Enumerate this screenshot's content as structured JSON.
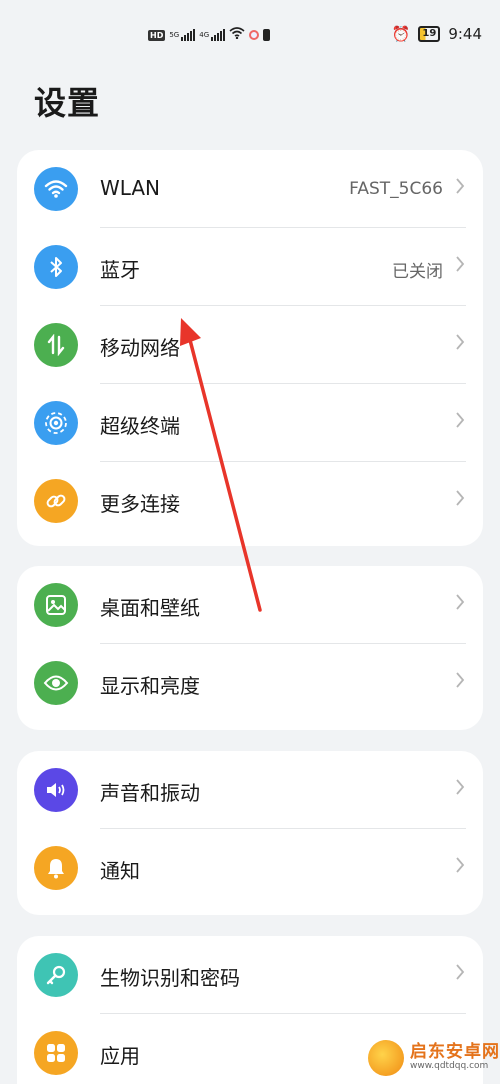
{
  "status_bar": {
    "hd_badge": "HD",
    "sim1_net": "5G",
    "sim2_net": "4G",
    "battery_level": "19",
    "time": "9:44",
    "icons": [
      "hd-icon",
      "signal-icon",
      "signal-icon",
      "wifi-icon",
      "app-dot-icon",
      "battery-small-icon",
      "alarm-icon",
      "battery-icon"
    ]
  },
  "header": {
    "title": "设置"
  },
  "groups": [
    {
      "items": [
        {
          "label": "WLAN",
          "value": "FAST_5C66",
          "icon": "wifi-icon",
          "color": "#3a9ef0"
        },
        {
          "label": "蓝牙",
          "value": "已关闭",
          "icon": "bluetooth-icon",
          "color": "#3a9ef0"
        },
        {
          "label": "移动网络",
          "value": "",
          "icon": "mobile-data-icon",
          "color": "#4caf50"
        },
        {
          "label": "超级终端",
          "value": "",
          "icon": "super-device-icon",
          "color": "#3a9ef0"
        },
        {
          "label": "更多连接",
          "value": "",
          "icon": "link-icon",
          "color": "#f5a623"
        }
      ]
    },
    {
      "items": [
        {
          "label": "桌面和壁纸",
          "value": "",
          "icon": "wallpaper-icon",
          "color": "#4caf50"
        },
        {
          "label": "显示和亮度",
          "value": "",
          "icon": "eye-icon",
          "color": "#4caf50"
        }
      ]
    },
    {
      "items": [
        {
          "label": "声音和振动",
          "value": "",
          "icon": "sound-icon",
          "color": "#5b48e6"
        },
        {
          "label": "通知",
          "value": "",
          "icon": "bell-icon",
          "color": "#f5a623"
        }
      ]
    },
    {
      "items": [
        {
          "label": "生物识别和密码",
          "value": "",
          "icon": "key-icon",
          "color": "#3fc4b4"
        },
        {
          "label": "应用",
          "value": "",
          "icon": "apps-icon",
          "color": "#f5a623"
        }
      ]
    }
  ],
  "annotation": {
    "type": "arrow",
    "color": "#e8352a"
  },
  "watermark": {
    "title": "启东安卓网",
    "url": "www.qdtdqq.com"
  }
}
